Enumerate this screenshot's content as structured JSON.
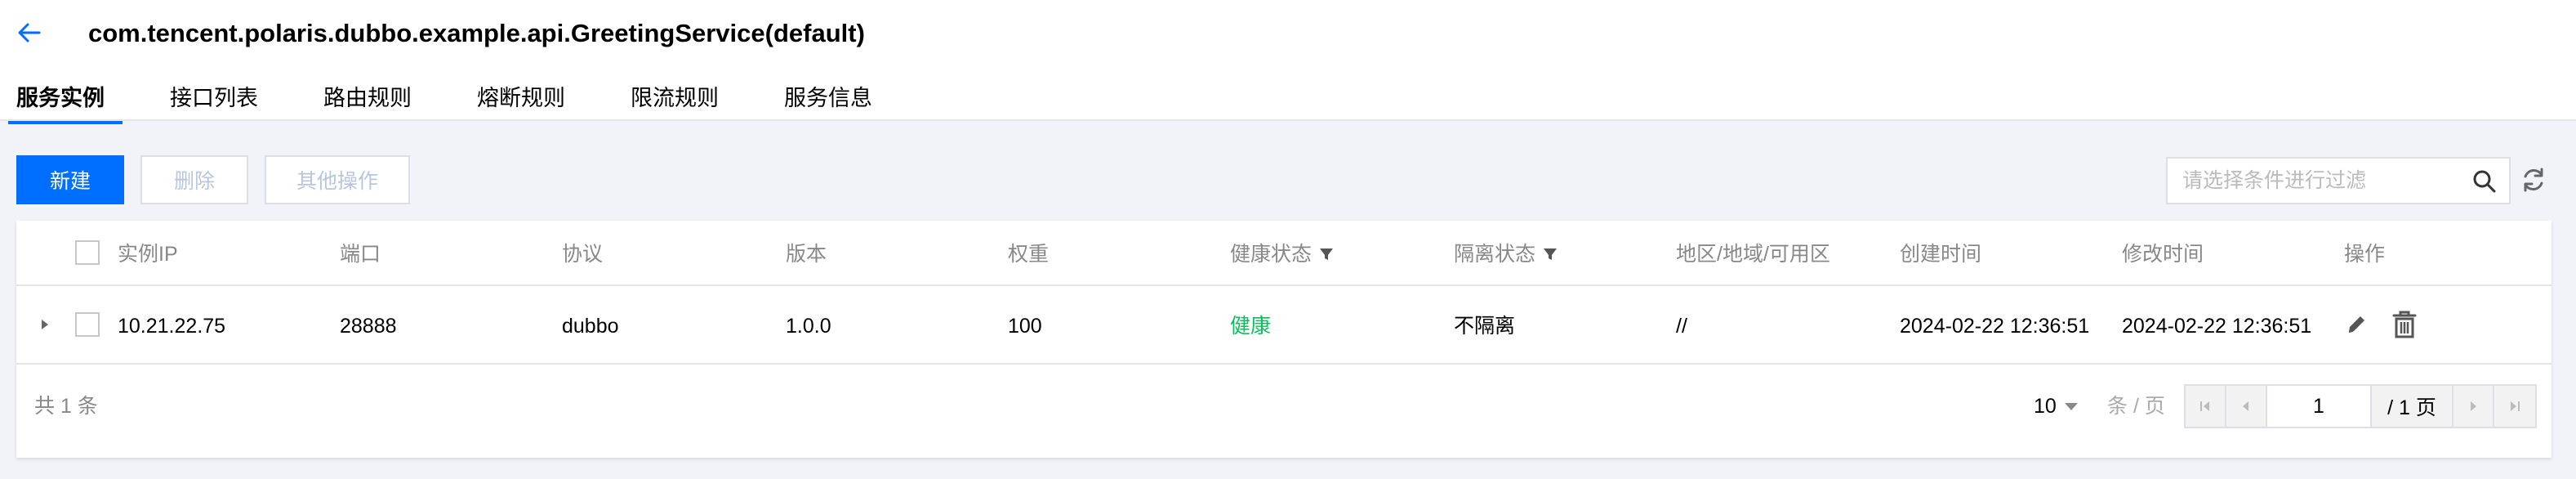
{
  "header": {
    "title": "com.tencent.polaris.dubbo.example.api.GreetingService(default)",
    "back_icon": "arrow-left-icon"
  },
  "tabs": [
    {
      "label": "服务实例",
      "active": true
    },
    {
      "label": "接口列表",
      "active": false
    },
    {
      "label": "路由规则",
      "active": false
    },
    {
      "label": "熔断规则",
      "active": false
    },
    {
      "label": "限流规则",
      "active": false
    },
    {
      "label": "服务信息",
      "active": false
    }
  ],
  "toolbar": {
    "new_label": "新建",
    "delete_label": "删除",
    "more_label": "其他操作",
    "search_placeholder": "请选择条件进行过滤"
  },
  "table": {
    "columns": [
      "实例IP",
      "端口",
      "协议",
      "版本",
      "权重",
      "健康状态",
      "隔离状态",
      "地区/地域/可用区",
      "创建时间",
      "修改时间",
      "操作"
    ],
    "rows": [
      {
        "ip": "10.21.22.75",
        "port": "28888",
        "protocol": "dubbo",
        "version": "1.0.0",
        "weight": "100",
        "health": "健康",
        "isolate": "不隔离",
        "location": "//",
        "created": "2024-02-22 12:36:51",
        "modified": "2024-02-22 12:36:51"
      }
    ]
  },
  "pagination": {
    "total_text": "共 1 条",
    "page_size": "10",
    "per_page_label": "条 / 页",
    "current_page": "1",
    "total_pages_text": "/ 1 页"
  },
  "colors": {
    "primary": "#006eff",
    "health_ok": "#0abf5b",
    "background": "#f2f3f8"
  }
}
